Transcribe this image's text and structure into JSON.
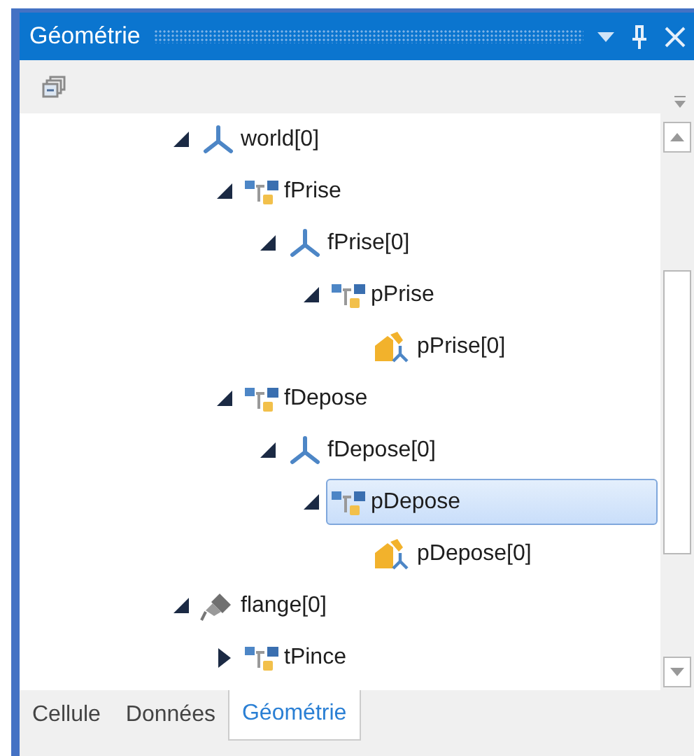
{
  "panel": {
    "title": "Géométrie"
  },
  "tree": [
    {
      "label": "world[0]",
      "kind": "frame",
      "expanded": true,
      "selected": false,
      "children": [
        {
          "label": "fPrise",
          "kind": "object",
          "expanded": true,
          "selected": false,
          "children": [
            {
              "label": "fPrise[0]",
              "kind": "frame",
              "expanded": true,
              "selected": false,
              "children": [
                {
                  "label": "pPrise",
                  "kind": "object",
                  "expanded": true,
                  "selected": false,
                  "children": [
                    {
                      "label": "pPrise[0]",
                      "kind": "target",
                      "selected": false
                    }
                  ]
                }
              ]
            }
          ]
        },
        {
          "label": "fDepose",
          "kind": "object",
          "expanded": true,
          "selected": false,
          "children": [
            {
              "label": "fDepose[0]",
              "kind": "frame",
              "expanded": true,
              "selected": false,
              "children": [
                {
                  "label": "pDepose",
                  "kind": "object",
                  "expanded": true,
                  "selected": true,
                  "children": [
                    {
                      "label": "pDepose[0]",
                      "kind": "target",
                      "selected": false
                    }
                  ]
                }
              ]
            }
          ]
        }
      ]
    },
    {
      "label": "flange[0]",
      "kind": "tool",
      "expanded": true,
      "selected": false,
      "children": [
        {
          "label": "tPince",
          "kind": "object",
          "expanded": false,
          "selected": false
        }
      ]
    }
  ],
  "tabs": [
    {
      "label": "Cellule",
      "selected": false
    },
    {
      "label": "Données",
      "selected": false
    },
    {
      "label": "Géométrie",
      "selected": true
    }
  ]
}
